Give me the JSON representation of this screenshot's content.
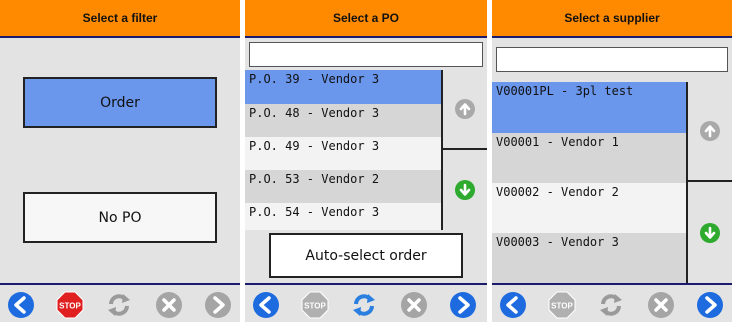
{
  "filter_panel": {
    "title": "Select a filter",
    "order_label": "Order",
    "no_po_label": "No PO"
  },
  "po_panel": {
    "title": "Select a PO",
    "search_value": "",
    "items": [
      "P.O. 39 - Vendor 3",
      "P.O. 48 - Vendor 3",
      "P.O. 49 - Vendor 3",
      "P.O. 53 - Vendor 2",
      "P.O. 54 - Vendor 3"
    ],
    "selected_index": 0,
    "auto_select_label": "Auto-select order"
  },
  "supplier_panel": {
    "title": "Select a supplier",
    "search_value": "",
    "items": [
      "V00001PL - 3pl test",
      "V00001 - Vendor 1",
      "V00002 - Vendor 2",
      "V00003 - Vendor 3"
    ],
    "selected_index": 0
  },
  "footer_icons": [
    "back-arrow-icon",
    "stop-icon",
    "refresh-icon",
    "cancel-icon",
    "forward-arrow-icon"
  ],
  "colors": {
    "header": "#ff8a00",
    "selected": "#6a96ec",
    "back_arrow": "#1e6be0",
    "stop_active": "#e02020",
    "confirm_green": "#2eaa2e"
  }
}
